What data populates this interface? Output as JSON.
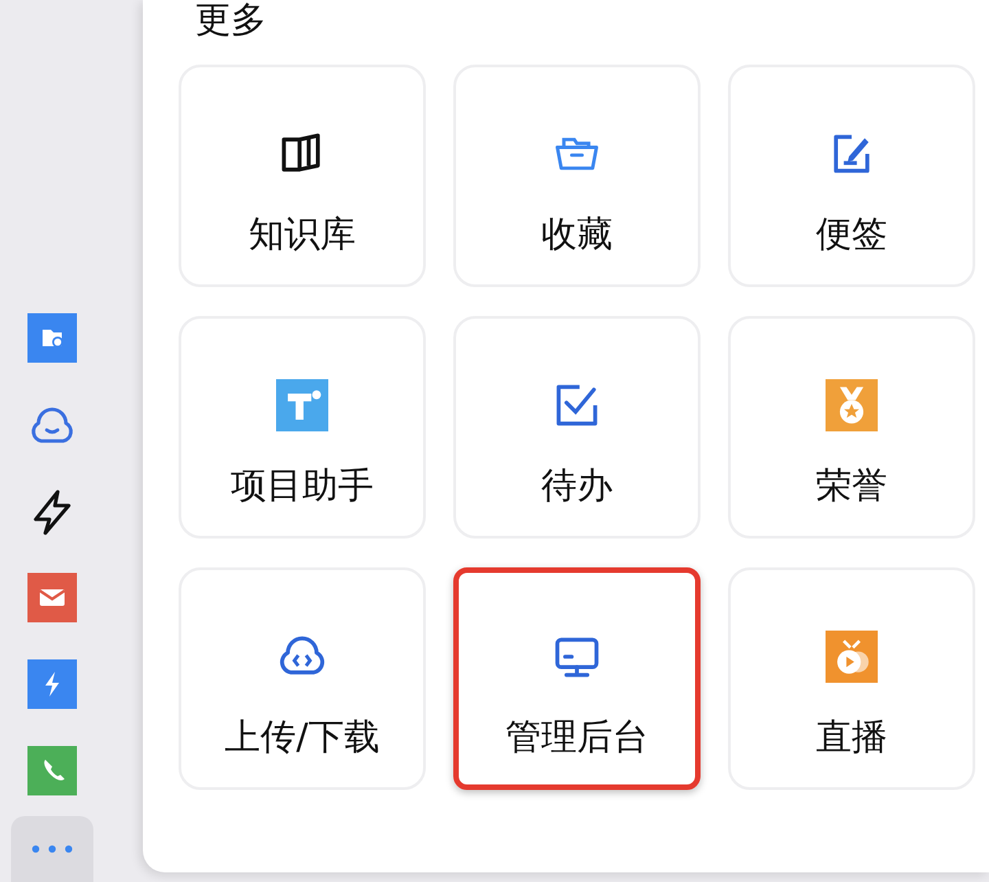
{
  "sidebar": {
    "items": [
      {
        "selected": false
      },
      {
        "selected": false
      },
      {
        "selected": false
      },
      {
        "selected": false
      },
      {
        "selected": false
      },
      {
        "selected": false
      },
      {
        "selected": true
      }
    ]
  },
  "panel": {
    "title": "更多",
    "items": [
      {
        "label": "知识库",
        "highlighted": false
      },
      {
        "label": "收藏",
        "highlighted": false
      },
      {
        "label": "便签",
        "highlighted": false
      },
      {
        "label": "项目助手",
        "highlighted": false
      },
      {
        "label": "待办",
        "highlighted": false
      },
      {
        "label": "荣誉",
        "highlighted": false
      },
      {
        "label": "上传/下载",
        "highlighted": false
      },
      {
        "label": "管理后台",
        "highlighted": true
      },
      {
        "label": "直播",
        "highlighted": false
      }
    ]
  }
}
